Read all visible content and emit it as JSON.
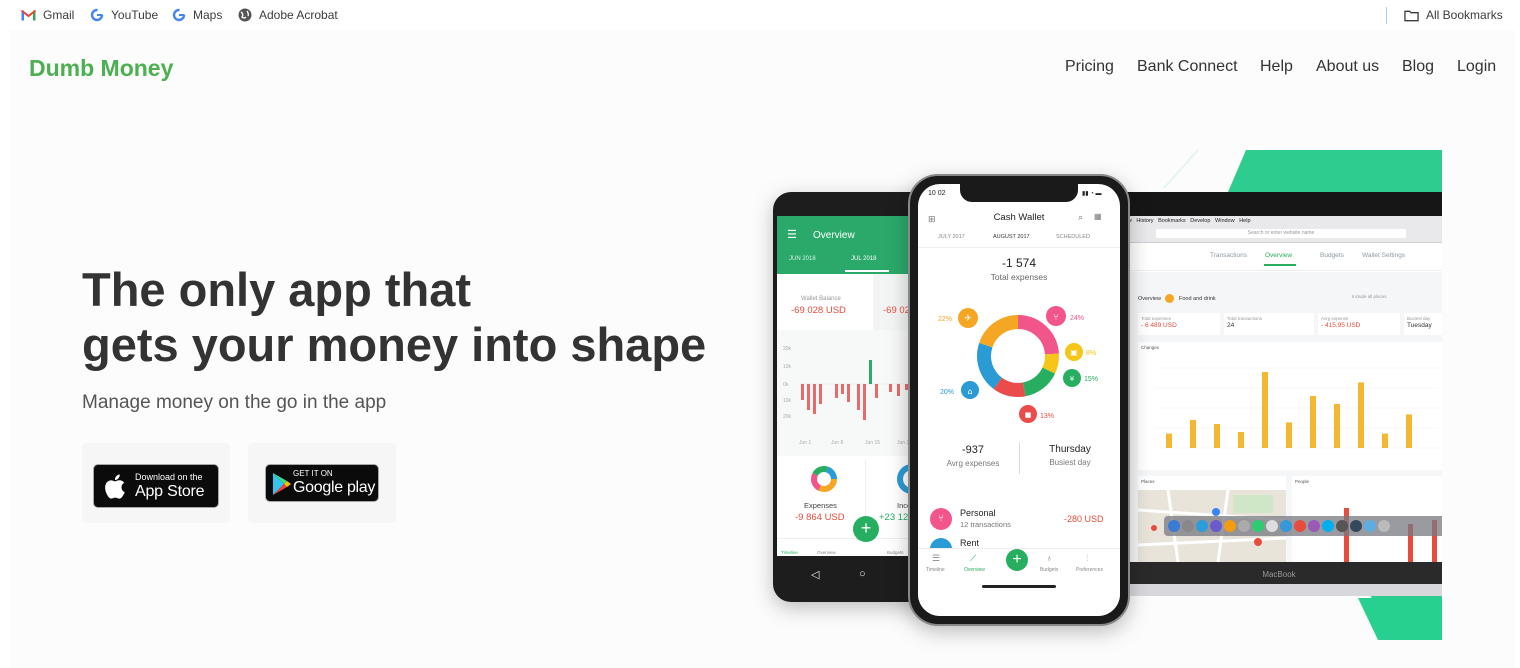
{
  "bookmarks_bar": {
    "items": [
      {
        "label": "Gmail",
        "icon": "gmail-icon"
      },
      {
        "label": "YouTube",
        "icon": "google-icon"
      },
      {
        "label": "Maps",
        "icon": "google-icon"
      },
      {
        "label": "Adobe Acrobat",
        "icon": "globe-icon"
      }
    ],
    "all_bookmarks": {
      "label": "All Bookmarks",
      "icon": "folder-icon"
    }
  },
  "site": {
    "logo": "Dumb Money",
    "logo_color": "#4caf50",
    "nav": [
      "Pricing",
      "Bank Connect",
      "Help",
      "About us",
      "Blog",
      "Login"
    ]
  },
  "hero": {
    "title_line1": "The only app that",
    "title_line2": "gets your money into shape",
    "subtitle": "Manage money on the go in the app",
    "app_store": {
      "small": "Download on the",
      "big": "App Store"
    },
    "google_play": {
      "small": "GET IT ON",
      "big": "Google play"
    }
  },
  "mockup": {
    "android": {
      "header": "Overview",
      "tabs": [
        "JUN 2018",
        "JUL 2018"
      ],
      "wallet_label": "Wallet Balance",
      "wallet_value": "-69 028 USD",
      "wallet_value_2": "-69 02",
      "axis": [
        "20k",
        "10k",
        "0k",
        "10k",
        "20k"
      ],
      "x_ticks": [
        "Jun 1",
        "Jun 8",
        "Jun 15",
        "Jun 22"
      ],
      "expenses_label": "Expenses",
      "expenses_value": "-9 864 USD",
      "income_label": "Inco",
      "income_value": "+23 12",
      "bottom_nav": [
        "Timeline",
        "Overview",
        "Budgets"
      ]
    },
    "iphone": {
      "time": "10 02",
      "title": "Cash Wallet",
      "tabs": [
        "JULY 2017",
        "AUGUST 2017",
        "SCHEDULED"
      ],
      "total_value": "-1 574",
      "total_label": "Total expenses",
      "segments": [
        {
          "pct": "24%",
          "color": "#f2558a"
        },
        {
          "pct": "8%",
          "color": "#f5c518"
        },
        {
          "pct": "15%",
          "color": "#27ae60"
        },
        {
          "pct": "13%",
          "color": "#ea4c4c"
        },
        {
          "pct": "20%",
          "color": "#2b9bd6"
        },
        {
          "pct": "22%",
          "color": "#f5a623"
        }
      ],
      "avg_value": "-937",
      "avg_label": "Avrg expenses",
      "day_value": "Thursday",
      "day_label": "Busiest day",
      "category": "Personal",
      "category_sub": "12 transactions",
      "category_value": "-280 USD",
      "next_category": "Rent",
      "bottom_nav": [
        "Timeline",
        "Overview",
        "Budgets",
        "Preferences"
      ]
    },
    "laptop": {
      "menu": [
        "View",
        "History",
        "Bookmarks",
        "Develop",
        "Window",
        "Help"
      ],
      "url_placeholder": "Search or enter website name",
      "tabs": [
        "Transactions",
        "Overview",
        "Budgets",
        "Wallet Settings"
      ],
      "breadcrumb": "Overview",
      "crumb_item": "Food and drink",
      "filter": "Include all places",
      "stats": [
        {
          "label": "Total expenses",
          "value": "- 6 489 USD"
        },
        {
          "label": "Total transactions",
          "value": "24"
        },
        {
          "label": "Avrg expense",
          "value": "- 415,95 USD"
        },
        {
          "label": "Busiest day",
          "value": "Tuesday"
        }
      ],
      "chart_title": "Changes",
      "bars": [
        0.18,
        0.35,
        0.3,
        0.2,
        0.95,
        0.32,
        0.65,
        0.55,
        0.82,
        0.18,
        0.42
      ],
      "places_title": "Places",
      "people_title": "People",
      "brand": "MacBook"
    }
  }
}
